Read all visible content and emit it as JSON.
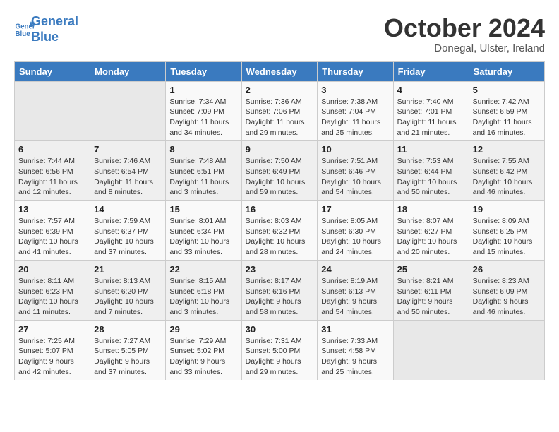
{
  "logo": {
    "line1": "General",
    "line2": "Blue"
  },
  "title": "October 2024",
  "subtitle": "Donegal, Ulster, Ireland",
  "headers": [
    "Sunday",
    "Monday",
    "Tuesday",
    "Wednesday",
    "Thursday",
    "Friday",
    "Saturday"
  ],
  "weeks": [
    [
      {
        "day": "",
        "info": ""
      },
      {
        "day": "",
        "info": ""
      },
      {
        "day": "1",
        "info": "Sunrise: 7:34 AM\nSunset: 7:09 PM\nDaylight: 11 hours\nand 34 minutes."
      },
      {
        "day": "2",
        "info": "Sunrise: 7:36 AM\nSunset: 7:06 PM\nDaylight: 11 hours\nand 29 minutes."
      },
      {
        "day": "3",
        "info": "Sunrise: 7:38 AM\nSunset: 7:04 PM\nDaylight: 11 hours\nand 25 minutes."
      },
      {
        "day": "4",
        "info": "Sunrise: 7:40 AM\nSunset: 7:01 PM\nDaylight: 11 hours\nand 21 minutes."
      },
      {
        "day": "5",
        "info": "Sunrise: 7:42 AM\nSunset: 6:59 PM\nDaylight: 11 hours\nand 16 minutes."
      }
    ],
    [
      {
        "day": "6",
        "info": "Sunrise: 7:44 AM\nSunset: 6:56 PM\nDaylight: 11 hours\nand 12 minutes."
      },
      {
        "day": "7",
        "info": "Sunrise: 7:46 AM\nSunset: 6:54 PM\nDaylight: 11 hours\nand 8 minutes."
      },
      {
        "day": "8",
        "info": "Sunrise: 7:48 AM\nSunset: 6:51 PM\nDaylight: 11 hours\nand 3 minutes."
      },
      {
        "day": "9",
        "info": "Sunrise: 7:50 AM\nSunset: 6:49 PM\nDaylight: 10 hours\nand 59 minutes."
      },
      {
        "day": "10",
        "info": "Sunrise: 7:51 AM\nSunset: 6:46 PM\nDaylight: 10 hours\nand 54 minutes."
      },
      {
        "day": "11",
        "info": "Sunrise: 7:53 AM\nSunset: 6:44 PM\nDaylight: 10 hours\nand 50 minutes."
      },
      {
        "day": "12",
        "info": "Sunrise: 7:55 AM\nSunset: 6:42 PM\nDaylight: 10 hours\nand 46 minutes."
      }
    ],
    [
      {
        "day": "13",
        "info": "Sunrise: 7:57 AM\nSunset: 6:39 PM\nDaylight: 10 hours\nand 41 minutes."
      },
      {
        "day": "14",
        "info": "Sunrise: 7:59 AM\nSunset: 6:37 PM\nDaylight: 10 hours\nand 37 minutes."
      },
      {
        "day": "15",
        "info": "Sunrise: 8:01 AM\nSunset: 6:34 PM\nDaylight: 10 hours\nand 33 minutes."
      },
      {
        "day": "16",
        "info": "Sunrise: 8:03 AM\nSunset: 6:32 PM\nDaylight: 10 hours\nand 28 minutes."
      },
      {
        "day": "17",
        "info": "Sunrise: 8:05 AM\nSunset: 6:30 PM\nDaylight: 10 hours\nand 24 minutes."
      },
      {
        "day": "18",
        "info": "Sunrise: 8:07 AM\nSunset: 6:27 PM\nDaylight: 10 hours\nand 20 minutes."
      },
      {
        "day": "19",
        "info": "Sunrise: 8:09 AM\nSunset: 6:25 PM\nDaylight: 10 hours\nand 15 minutes."
      }
    ],
    [
      {
        "day": "20",
        "info": "Sunrise: 8:11 AM\nSunset: 6:23 PM\nDaylight: 10 hours\nand 11 minutes."
      },
      {
        "day": "21",
        "info": "Sunrise: 8:13 AM\nSunset: 6:20 PM\nDaylight: 10 hours\nand 7 minutes."
      },
      {
        "day": "22",
        "info": "Sunrise: 8:15 AM\nSunset: 6:18 PM\nDaylight: 10 hours\nand 3 minutes."
      },
      {
        "day": "23",
        "info": "Sunrise: 8:17 AM\nSunset: 6:16 PM\nDaylight: 9 hours\nand 58 minutes."
      },
      {
        "day": "24",
        "info": "Sunrise: 8:19 AM\nSunset: 6:13 PM\nDaylight: 9 hours\nand 54 minutes."
      },
      {
        "day": "25",
        "info": "Sunrise: 8:21 AM\nSunset: 6:11 PM\nDaylight: 9 hours\nand 50 minutes."
      },
      {
        "day": "26",
        "info": "Sunrise: 8:23 AM\nSunset: 6:09 PM\nDaylight: 9 hours\nand 46 minutes."
      }
    ],
    [
      {
        "day": "27",
        "info": "Sunrise: 7:25 AM\nSunset: 5:07 PM\nDaylight: 9 hours\nand 42 minutes."
      },
      {
        "day": "28",
        "info": "Sunrise: 7:27 AM\nSunset: 5:05 PM\nDaylight: 9 hours\nand 37 minutes."
      },
      {
        "day": "29",
        "info": "Sunrise: 7:29 AM\nSunset: 5:02 PM\nDaylight: 9 hours\nand 33 minutes."
      },
      {
        "day": "30",
        "info": "Sunrise: 7:31 AM\nSunset: 5:00 PM\nDaylight: 9 hours\nand 29 minutes."
      },
      {
        "day": "31",
        "info": "Sunrise: 7:33 AM\nSunset: 4:58 PM\nDaylight: 9 hours\nand 25 minutes."
      },
      {
        "day": "",
        "info": ""
      },
      {
        "day": "",
        "info": ""
      }
    ]
  ]
}
